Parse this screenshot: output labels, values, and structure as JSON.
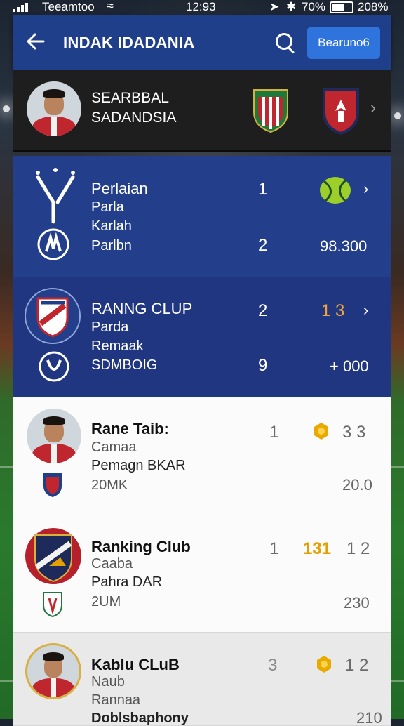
{
  "status_bar": {
    "carrier": "Teeamtoo",
    "time": "12:93",
    "battery_pct_left": "70%",
    "battery_pct_right": "208%"
  },
  "header": {
    "title": "INDAK IDADANIA",
    "action_label": "Bearuno6"
  },
  "match": {
    "player_line1": "SEARBBAL",
    "player_line2": "SADANDSIA"
  },
  "cards": [
    {
      "title": "Perlaian",
      "line2": "Parla",
      "line3": "Karlah",
      "line4": "Parlbn",
      "num_top": "1",
      "num_bottom": "2",
      "value": "98.300"
    },
    {
      "title": "RANNG CLUP",
      "line2": "Parda",
      "line3": "Remaak",
      "line4": "SDMBOIG",
      "num_top": "2",
      "num_bottom": "9",
      "rank_top": "1 3",
      "value": "+ 000"
    },
    {
      "title": "Rane Taib:",
      "line2": "Camaa",
      "line3": "Pemagn BKAR",
      "line4": "20MK",
      "num_left": "1",
      "num_right": "3 3",
      "value": "20.0"
    },
    {
      "title": "Ranking Club",
      "line2": "Caaba",
      "line3": "Pahra DAR",
      "line4": "2UM",
      "num_left": "1",
      "rank": "131",
      "num_right": "1 2",
      "value": "230"
    },
    {
      "title": "Kablu CLuB",
      "line2": "Naub",
      "line3": "Rannaa",
      "line4": "Doblsbaphony",
      "num_left": "3",
      "num_right": "1 2",
      "value": "210"
    }
  ],
  "colors": {
    "header_blue": "#1f3f8a",
    "button_blue": "#2f73dc",
    "card_blue": "#233f8c",
    "gold": "#e4a000"
  },
  "icons": [
    "back-arrow-icon",
    "search-icon",
    "chevron-right-icon",
    "coin-icon"
  ]
}
